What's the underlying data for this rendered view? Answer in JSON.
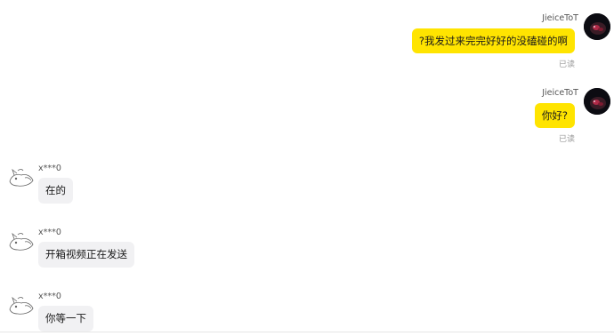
{
  "messages": [
    {
      "side": "out",
      "sender": "JieiceToT",
      "text": "?我发过来完完好好的没磕碰的啊",
      "status": "已读",
      "avatar": "dark-anime-avatar"
    },
    {
      "side": "out",
      "sender": "JieiceToT",
      "text": "你好?",
      "status": "已读",
      "avatar": "dark-anime-avatar"
    },
    {
      "side": "in",
      "sender": "x***0",
      "text": "在的",
      "avatar": "sketch-cat-avatar"
    },
    {
      "side": "in",
      "sender": "x***0",
      "text": "开箱视频正在发送",
      "avatar": "sketch-cat-avatar"
    },
    {
      "side": "in",
      "sender": "x***0",
      "text": "你等一下",
      "avatar": "sketch-cat-avatar"
    }
  ],
  "colors": {
    "outgoing_bubble": "#ffe400",
    "incoming_bubble": "#f1f1f3",
    "read_status": "#9a9a9a"
  }
}
